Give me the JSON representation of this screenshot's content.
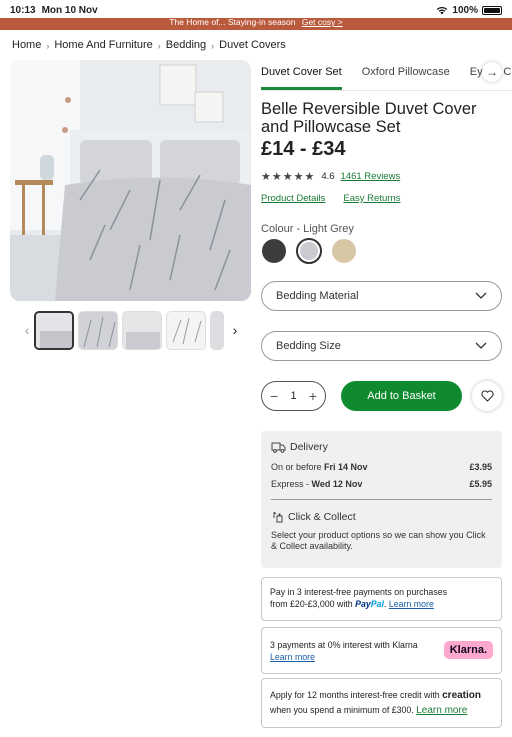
{
  "status_bar": {
    "time": "10:13",
    "date": "Mon 10 Nov",
    "battery": "100%"
  },
  "promo": {
    "text": "The Home of... Staying-in season",
    "link": "Get cosy >"
  },
  "breadcrumb": [
    "Home",
    "Home And Furniture",
    "Bedding",
    "Duvet Covers"
  ],
  "tabs": [
    "Duvet Cover Set",
    "Oxford Pillowcase",
    "Eyelet Curtains"
  ],
  "product": {
    "title": "Belle Reversible Duvet Cover and Pillowcase Set",
    "price": "£14 - £34",
    "rating": "4.6",
    "reviews": "1461 Reviews",
    "stars": "★★★★★"
  },
  "links": {
    "details": "Product Details",
    "returns": "Easy Returns"
  },
  "colour": {
    "label": "Colour - Light Grey",
    "swatches": [
      "#3c3c3c",
      "#cbcbd1",
      "#d7c7a4"
    ]
  },
  "dropdowns": {
    "material": "Bedding Material",
    "size": "Bedding Size"
  },
  "purchase": {
    "quantity": "1",
    "add_label": "Add to Basket"
  },
  "delivery": {
    "heading": "Delivery",
    "standard_prefix": "On or before ",
    "standard_date": "Fri 14 Nov",
    "standard_price": "£3.95",
    "express_prefix": "Express - ",
    "express_date": "Wed 12 Nov",
    "express_price": "£5.95",
    "cc_heading": "Click & Collect",
    "cc_desc": "Select your product options so we can show you Click & Collect availability."
  },
  "paypal": {
    "line1": "Pay in 3 interest-free payments on purchases",
    "line2_prefix": "from £20-£3,000 with ",
    "logo_pay": "Pay",
    "logo_pal": "Pal",
    "learn": "Learn more"
  },
  "klarna": {
    "line": "3 payments at 0% interest with Klarna",
    "learn": "Learn more",
    "badge": "Klarna."
  },
  "creation": {
    "line1": "Apply for 12 months interest-free credit with ",
    "logo": "creation",
    "line2": "when you spend a minimum of £300.",
    "learn": "Learn more"
  },
  "colors": {
    "accent_green": "#0f8a2f",
    "banner": "#b95a3c"
  }
}
